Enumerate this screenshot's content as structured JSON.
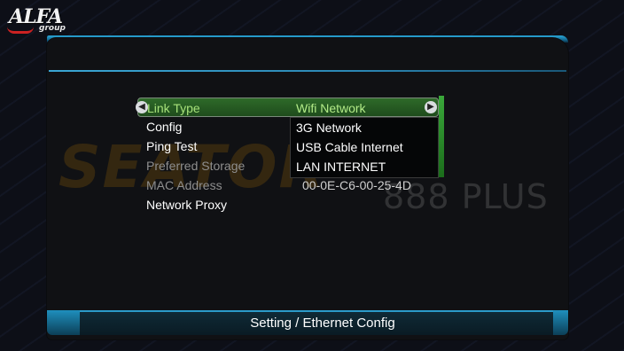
{
  "brand": {
    "name": "ALFA",
    "sub": "group"
  },
  "watermark": {
    "main": "SEATOR",
    "sub": "888 PLUS"
  },
  "menu": {
    "items": [
      {
        "label": "Link Type",
        "value": "Wifi Network",
        "state": "selected"
      },
      {
        "label": "Config",
        "value": "",
        "state": "enabled"
      },
      {
        "label": "Ping Test",
        "value": "",
        "state": "enabled"
      },
      {
        "label": "Preferred Storage",
        "value": "",
        "state": "disabled"
      },
      {
        "label": "MAC Address",
        "value": "00-0E-C6-00-25-4D",
        "state": "disabled"
      },
      {
        "label": "Network Proxy",
        "value": "",
        "state": "enabled"
      }
    ]
  },
  "dropdown": {
    "options": [
      "3G Network",
      "USB Cable Internet",
      "LAN INTERNET"
    ]
  },
  "footer": {
    "title": "Setting / Ethernet Config"
  },
  "colors": {
    "accent": "#2aa7d8",
    "selected": "#2e6a29",
    "selected_text": "#a7e27a"
  }
}
